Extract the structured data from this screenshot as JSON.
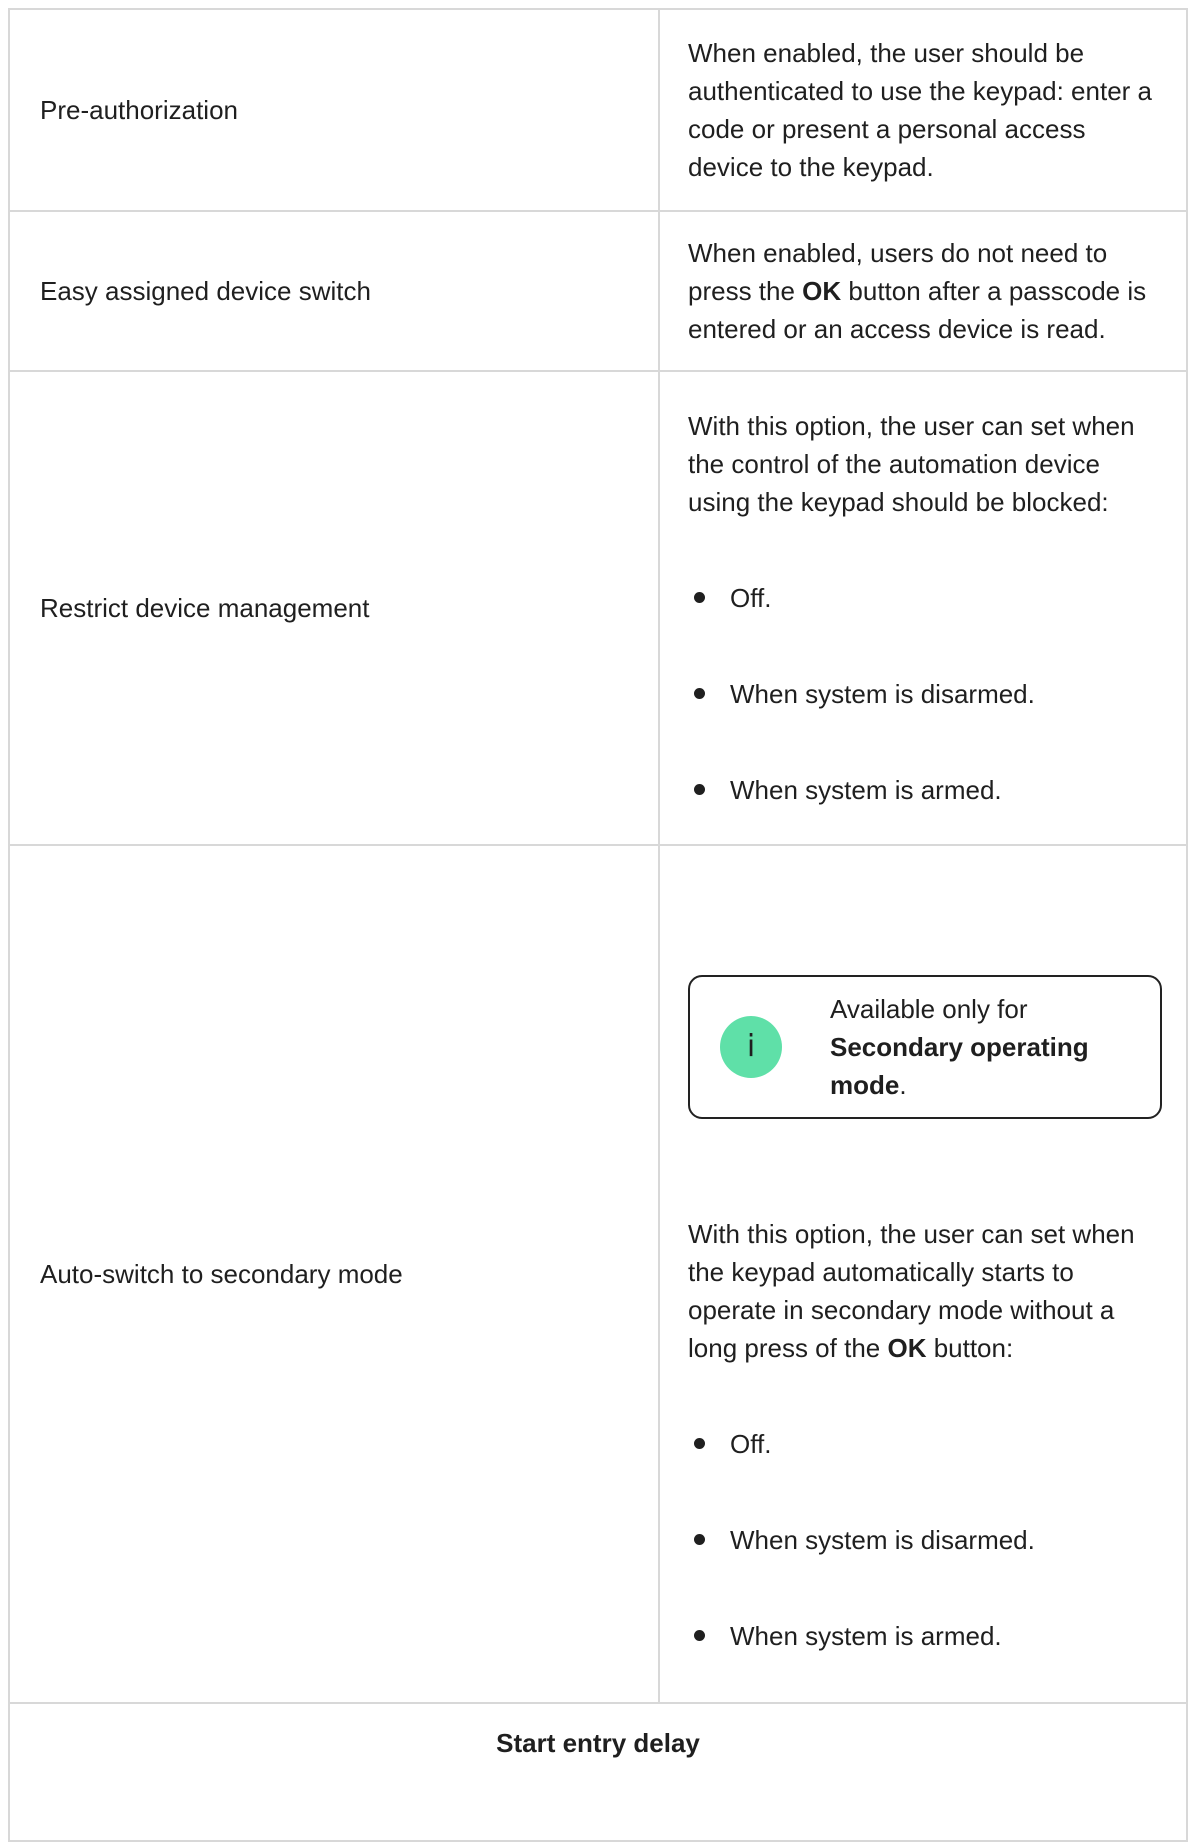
{
  "rows": [
    {
      "setting": "Pre-authorization",
      "desc": "When enabled, the user should be authenticated to use the keypad: enter a code or present a personal access device to the keypad."
    },
    {
      "setting": "Easy assigned device switch",
      "desc_pre": "When enabled, users do not need to press the ",
      "desc_bold": "OK",
      "desc_post": " button after a passcode is entered or an access device is read."
    },
    {
      "setting": "Restrict device management",
      "desc": "With this option, the user can set when the control of the automation device using the keypad should be blocked:",
      "options": [
        "Off.",
        "When system is disarmed.",
        "When system is armed."
      ]
    },
    {
      "setting": "Auto-switch to secondary mode",
      "note_icon": "info-icon",
      "note_glyph": "i",
      "note_pre": "Available only for ",
      "note_bold": "Secondary operating mode",
      "note_post": ".",
      "desc_pre": "With this option, the user can set when the keypad automatically starts to operate in secondary mode without a long press of the ",
      "desc_bold": "OK",
      "desc_post": " button:",
      "options": [
        "Off.",
        "When system is disarmed.",
        "When system is armed."
      ]
    }
  ],
  "section_header": "Start entry delay",
  "colors": {
    "border": "#d8d8d8",
    "info_accent": "#5fe0a8",
    "text": "#1f1f1f"
  }
}
